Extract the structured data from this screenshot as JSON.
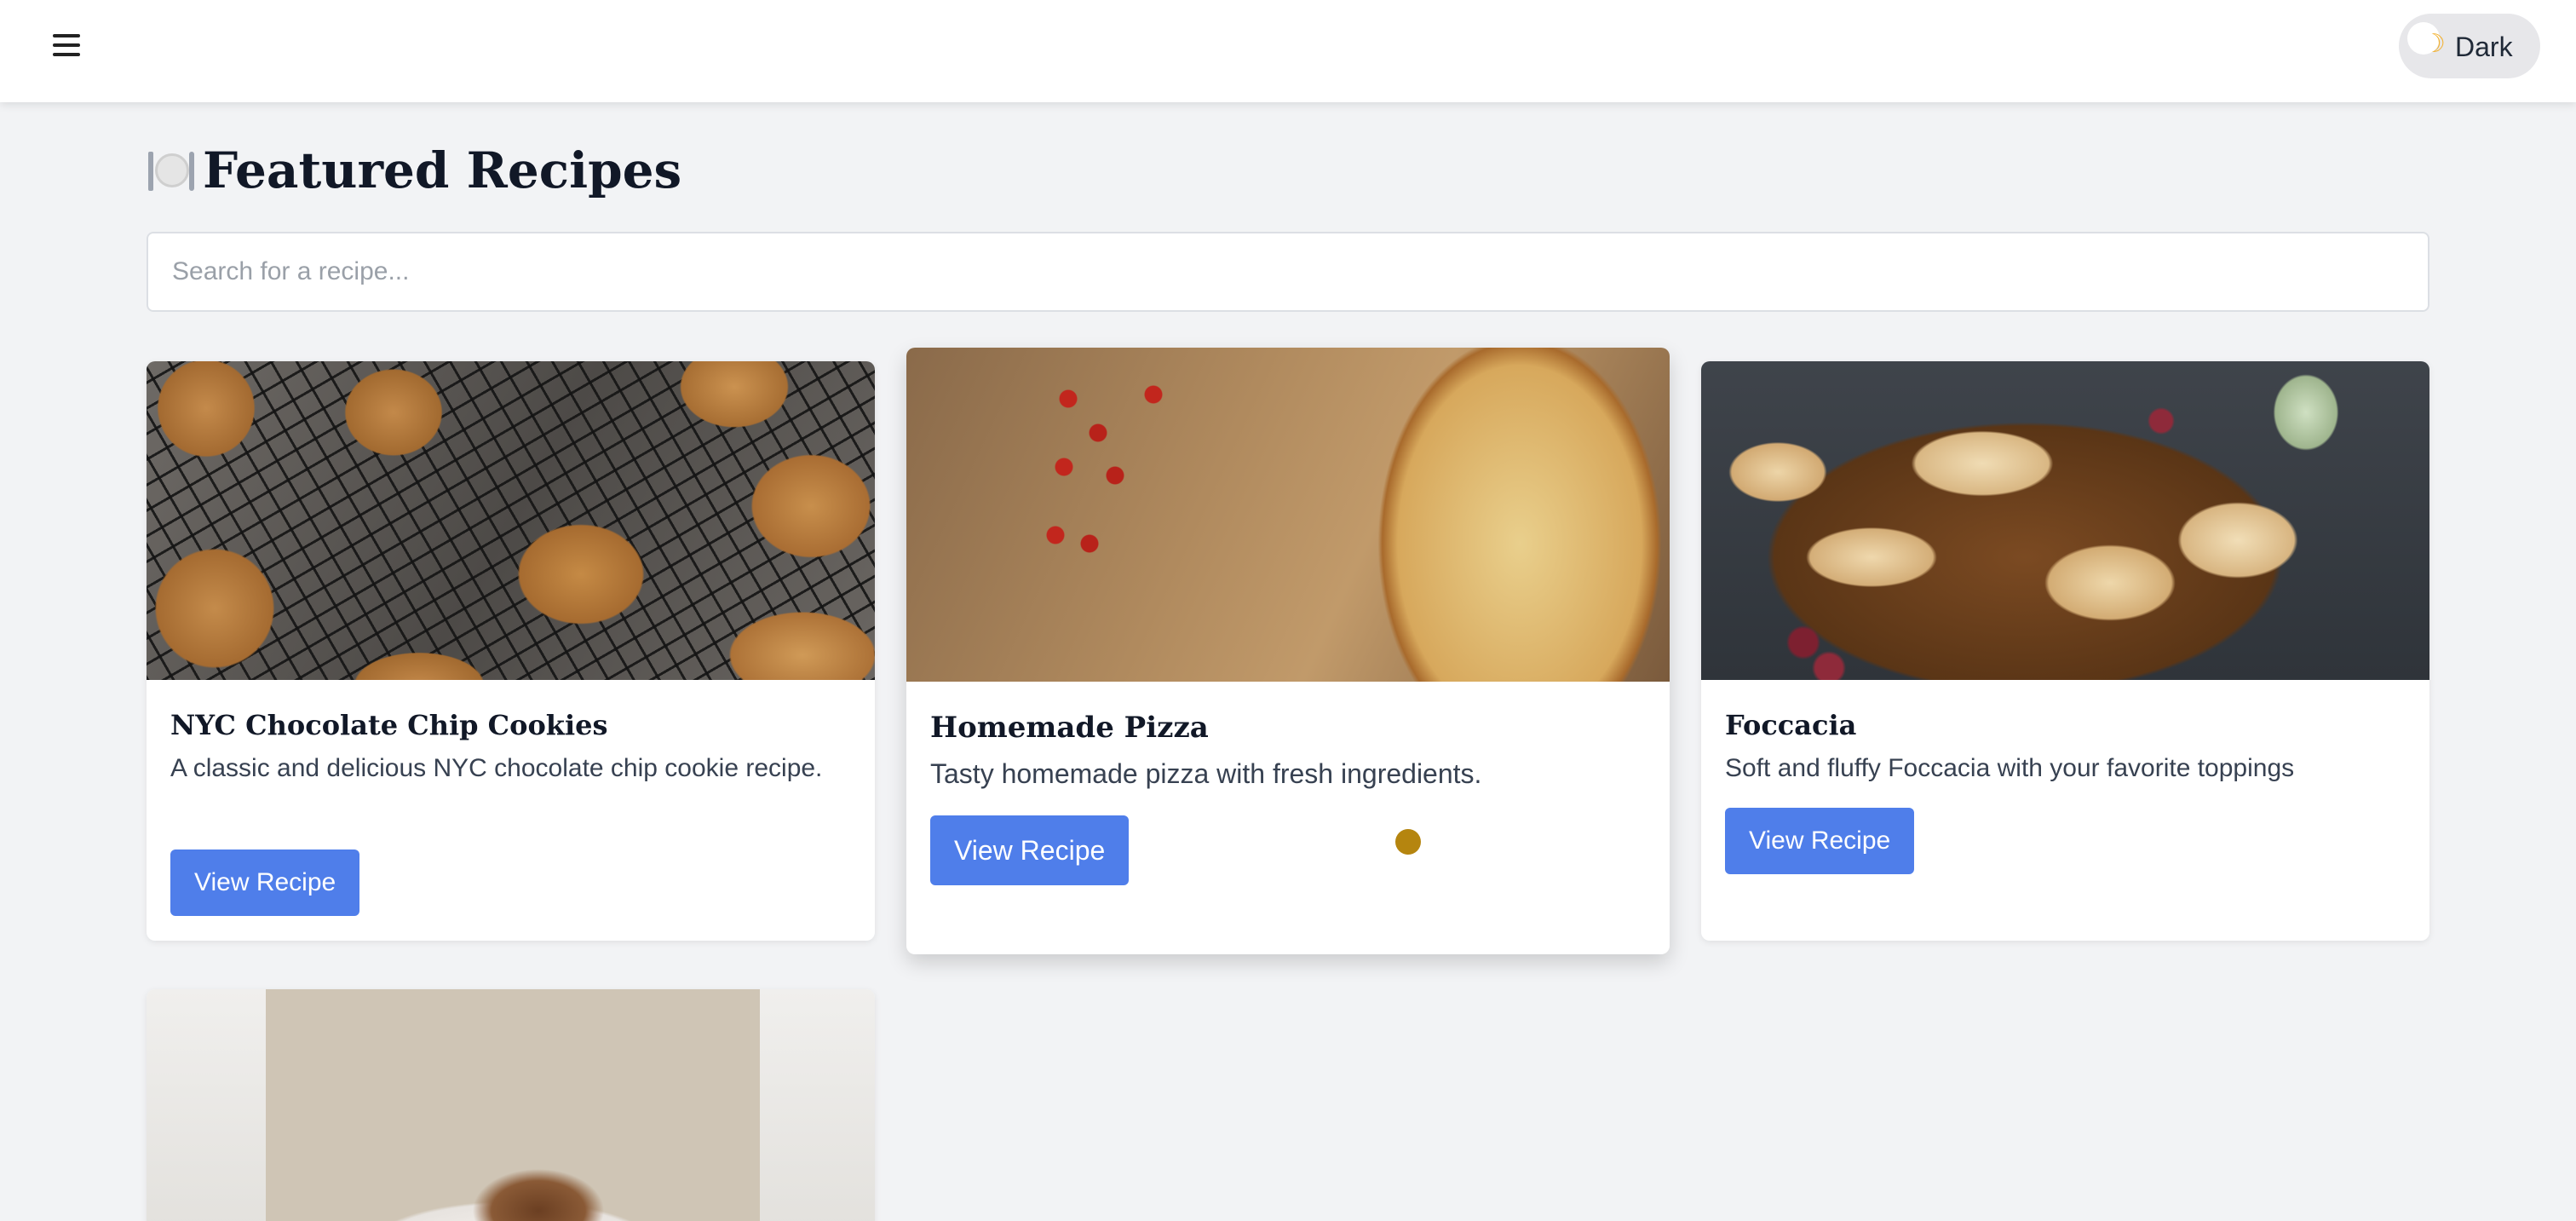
{
  "header": {
    "menu_icon": "hamburger-menu-icon",
    "theme_toggle": {
      "icon": "moon-icon",
      "label": "Dark"
    }
  },
  "page": {
    "title": "Featured Recipes",
    "title_icon": "plate-with-cutlery-icon"
  },
  "search": {
    "placeholder": "Search for a recipe...",
    "value": ""
  },
  "recipes": [
    {
      "title": "NYC Chocolate Chip Cookies",
      "description": "A classic and delicious NYC chocolate chip cookie recipe.",
      "button_label": "View Recipe",
      "image": "cookies-on-cooling-rack"
    },
    {
      "title": "Homemade Pizza",
      "description": "Tasty homemade pizza with fresh ingredients.",
      "button_label": "View Recipe",
      "image": "sliced-pizza-with-tomatoes"
    },
    {
      "title": "Foccacia",
      "description": "Soft and fluffy Foccacia with your favorite toppings",
      "button_label": "View Recipe",
      "image": "foccacia-bread-with-grapes"
    },
    {
      "title": "",
      "description": "",
      "button_label": "",
      "image": "person-holding-tiramisu-plate"
    }
  ],
  "colors": {
    "accent": "#4f7eea",
    "background": "#f2f3f5",
    "cursor_dot": "#b5850f"
  }
}
